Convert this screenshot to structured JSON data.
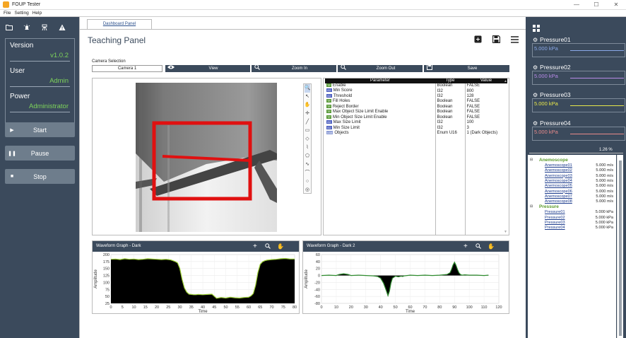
{
  "window": {
    "title": "FOUP Tester",
    "min": "—",
    "max": "☐",
    "close": "✕"
  },
  "menu": [
    "File",
    "Setting",
    "Help"
  ],
  "left": {
    "icons": [
      "folder-icon",
      "alarm-icon",
      "robot-icon",
      "warning-icon"
    ],
    "version_label": "Version",
    "version_value": "v1.0.2",
    "user_label": "User",
    "user_value": "Admin",
    "power_label": "Power",
    "power_value": "Administrator",
    "start_label": "Start",
    "pause_label": "Pause",
    "stop_label": "Stop"
  },
  "main": {
    "tab_label": "Dashboard Panel",
    "page_title": "Teaching Panel",
    "camera_label": "Camera Selection",
    "camera_value": "Camera 1",
    "view_label": "View",
    "zoom_in_label": "Zoom In",
    "zoom_out_label": "Zoom Out",
    "save_label": "Save"
  },
  "params": {
    "headers": [
      "Parameter",
      "Type",
      "Valuie"
    ],
    "rows": [
      {
        "tag": "TF",
        "tagcls": "g",
        "name": "Enable",
        "type": "Boolean",
        "value": "FALSE"
      },
      {
        "tag": "I32",
        "tagcls": "",
        "name": "Min Score",
        "type": "I32",
        "value": "800"
      },
      {
        "tag": "I32",
        "tagcls": "",
        "name": "Threshold",
        "type": "I32",
        "value": "128"
      },
      {
        "tag": "TF",
        "tagcls": "g",
        "name": "Fill Holes",
        "type": "Boolean",
        "value": "FALSE"
      },
      {
        "tag": "TF",
        "tagcls": "g",
        "name": "Reject Border",
        "type": "Boolean",
        "value": "FALSE"
      },
      {
        "tag": "TF",
        "tagcls": "g",
        "name": "Max Object Size Limit Enable",
        "type": "Boolean",
        "value": "FALSE"
      },
      {
        "tag": "TF",
        "tagcls": "g",
        "name": "Min Object Size Limit Enable",
        "type": "Boolean",
        "value": "FALSE"
      },
      {
        "tag": "I32",
        "tagcls": "",
        "name": "Max Size Limit",
        "type": "I32",
        "value": "100"
      },
      {
        "tag": "I32",
        "tagcls": "",
        "name": "Min Size Limit",
        "type": "I32",
        "value": "3"
      },
      {
        "tag": "U16",
        "tagcls": "e",
        "name": "Objects",
        "type": "Enum U16",
        "value": "1 (Dark Objects)"
      }
    ]
  },
  "chart_data": [
    {
      "type": "line",
      "title": "Waveform Graph - Dark",
      "xlabel": "Time",
      "ylabel": "Amplitude",
      "xlim": [
        0,
        80
      ],
      "ylim": [
        25,
        200
      ],
      "xticks": [
        0,
        5,
        10,
        15,
        20,
        25,
        30,
        35,
        40,
        45,
        50,
        55,
        60,
        65,
        70,
        75,
        80
      ],
      "yticks": [
        25,
        50,
        75,
        100,
        125,
        150,
        175,
        200
      ],
      "fill": true,
      "x": [
        0,
        2,
        4,
        6,
        8,
        10,
        12,
        14,
        16,
        18,
        20,
        22,
        24,
        26,
        27,
        28,
        29,
        30,
        31,
        32,
        33,
        34,
        35,
        36,
        37,
        38,
        40,
        42,
        44,
        46,
        48,
        50,
        52,
        54,
        56,
        58,
        60,
        61,
        62,
        63,
        64,
        65,
        66,
        67,
        68,
        70,
        72,
        74,
        76,
        78,
        80
      ],
      "y": [
        183,
        184,
        182,
        185,
        183,
        184,
        182,
        183,
        185,
        184,
        183,
        182,
        183,
        181,
        178,
        175,
        170,
        150,
        110,
        80,
        65,
        58,
        57,
        56,
        56,
        57,
        56,
        57,
        58,
        43,
        46,
        44,
        47,
        45,
        44,
        46,
        47,
        52,
        60,
        90,
        135,
        165,
        174,
        178,
        180,
        182,
        183,
        185,
        186,
        184,
        184
      ]
    },
    {
      "type": "line",
      "title": "Waveform Graph - Dark 2",
      "xlabel": "Time",
      "ylabel": "Amplitude",
      "xlim": [
        0,
        120
      ],
      "ylim": [
        -80,
        60
      ],
      "xticks": [
        0,
        10,
        20,
        30,
        40,
        50,
        60,
        70,
        80,
        90,
        100,
        110,
        120
      ],
      "yticks": [
        -80,
        -60,
        -40,
        -20,
        0,
        20,
        40,
        60
      ],
      "fill": true,
      "x": [
        0,
        5,
        10,
        12,
        15,
        18,
        20,
        25,
        30,
        35,
        38,
        40,
        42,
        44,
        45,
        46,
        47,
        48,
        50,
        52,
        54,
        55,
        56,
        58,
        60,
        65,
        70,
        75,
        80,
        85,
        87,
        88,
        89,
        90,
        91,
        92,
        93,
        94,
        95,
        97,
        100,
        105,
        110,
        113
      ],
      "y": [
        0,
        1,
        0,
        3,
        5,
        3,
        0,
        1,
        0,
        -1,
        -3,
        -8,
        -22,
        -45,
        -58,
        -45,
        -22,
        -8,
        -2,
        -4,
        -2,
        -3,
        -1,
        0,
        1,
        0,
        1,
        0,
        1,
        3,
        8,
        18,
        30,
        38,
        30,
        18,
        8,
        3,
        1,
        2,
        1,
        1,
        0,
        1
      ]
    }
  ],
  "right": {
    "icon": "grid-icon",
    "pressures": [
      {
        "name": "Pressure01",
        "value": "5.000 kPa",
        "color": "#8aa8e8"
      },
      {
        "name": "Pressure02",
        "value": "5.000 kPa",
        "color": "#b88ae8"
      },
      {
        "name": "Pressure03",
        "value": "5.000 kPa",
        "color": "#e8e84a"
      },
      {
        "name": "Pressure04",
        "value": "5.000 kPa",
        "color": "#e88a8a"
      }
    ],
    "progress": "1.26 %",
    "tree": [
      {
        "group": true,
        "label": "Anemoscope"
      },
      {
        "label": "Anemoscope01",
        "value": "5.000 m/s"
      },
      {
        "label": "Anemoscope02",
        "value": "5.000 m/s"
      },
      {
        "label": "Anemoscope03",
        "value": "5.000 m/s"
      },
      {
        "label": "Anemoscope04",
        "value": "5.000 m/s"
      },
      {
        "label": "Anemoscope05",
        "value": "5.000 m/s"
      },
      {
        "label": "Anemoscope06",
        "value": "5.000 m/s"
      },
      {
        "label": "Anemoscope07",
        "value": "5.000 m/s"
      },
      {
        "label": "Anemoscope08",
        "value": "5.000 m/s"
      },
      {
        "group": true,
        "label": "Pressure"
      },
      {
        "label": "Pressure01",
        "value": "5.000 kPa"
      },
      {
        "label": "Pressure02",
        "value": "5.000 kPa"
      },
      {
        "label": "Pressure03",
        "value": "5.000 kPa"
      },
      {
        "label": "Pressure04",
        "value": "5.000 kPa"
      }
    ]
  }
}
